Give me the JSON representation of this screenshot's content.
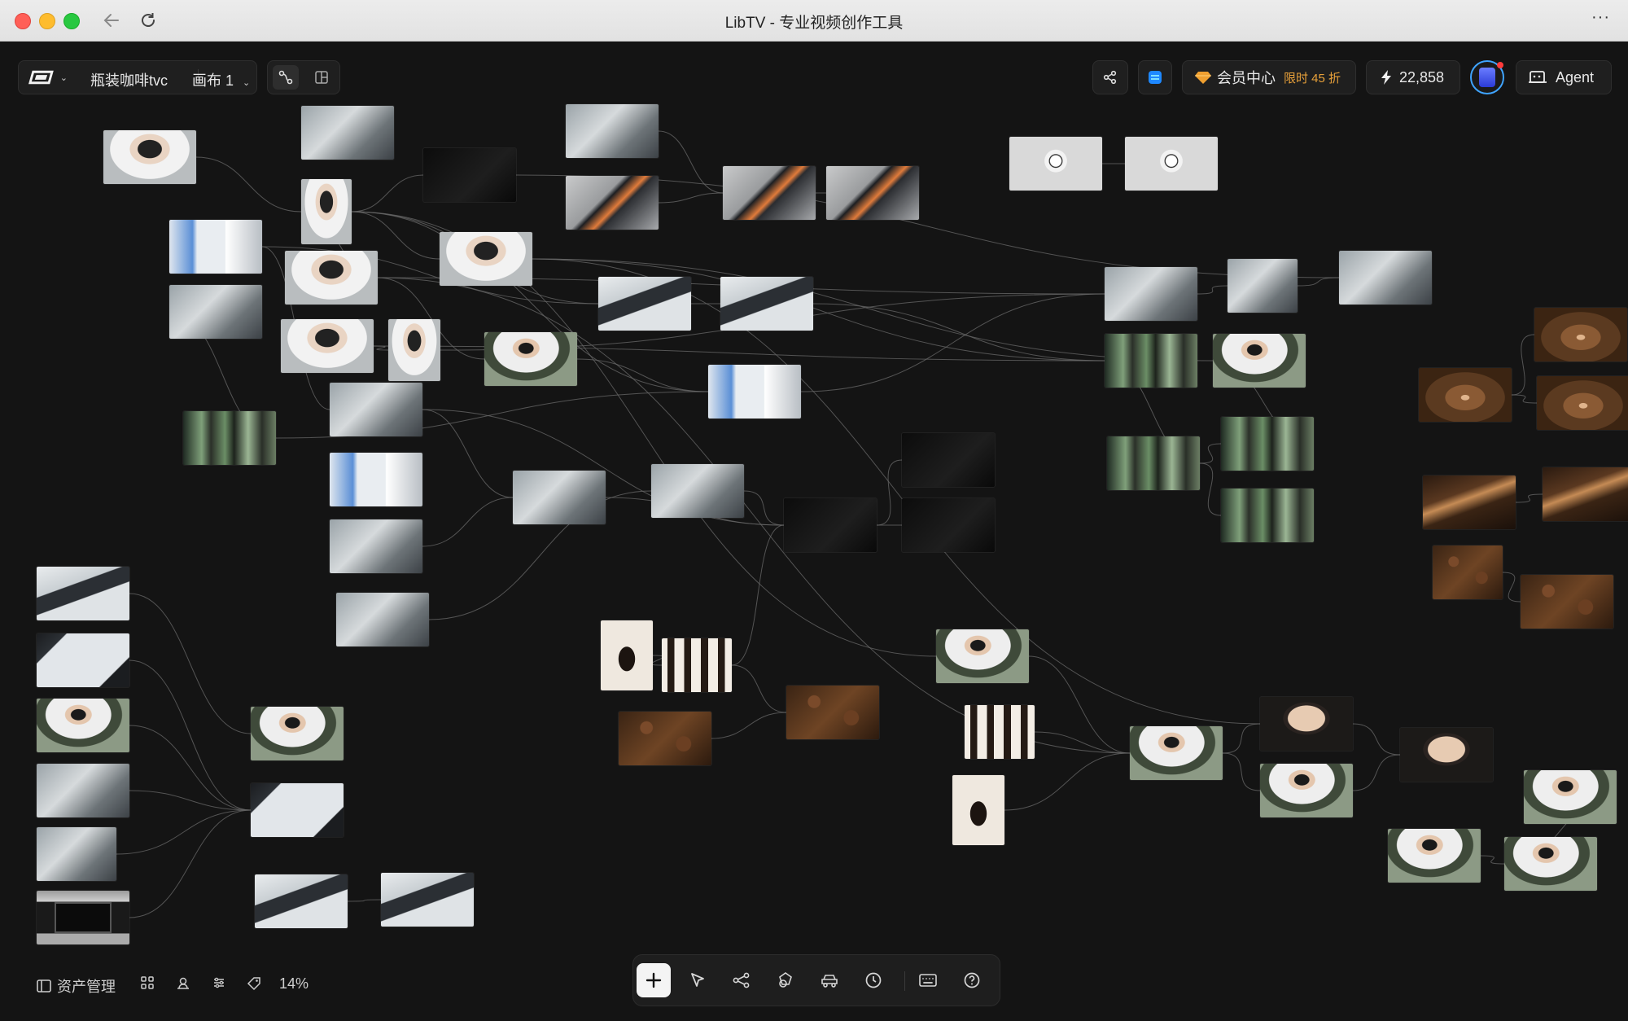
{
  "window": {
    "title": "LibTV - 专业视频创作工具",
    "traffic_lights": [
      "close",
      "minimize",
      "zoom"
    ],
    "nav_icons": [
      "back-arrow-icon",
      "reload-icon"
    ],
    "more_icon": "more-dots-icon"
  },
  "toolbar_left": {
    "logo_icon": "libtv-logo-icon",
    "project_name": "瓶装咖啡tvc",
    "canvas_name": "画布 1",
    "view_icons": [
      "connect-mode-icon",
      "layout-panel-icon"
    ]
  },
  "toolbar_right": {
    "share_icon": "share-icon",
    "app_icon": "storage-icon",
    "member_label": "会员中心",
    "member_promo": "限时 45 折",
    "credits": "22,858",
    "agent_label": "Agent"
  },
  "bottom_left": {
    "asset_label": "资产管理",
    "icons": [
      "grid-icon",
      "user-icon",
      "filter-icon",
      "tag-icon"
    ],
    "zoom": "14%"
  },
  "bottom_tools": [
    {
      "name": "add-node-tool",
      "icon": "plus-icon",
      "active": true
    },
    {
      "name": "select-tool",
      "icon": "cursor-icon",
      "active": false
    },
    {
      "name": "workflow-tool",
      "icon": "share-nodes-icon",
      "active": false
    },
    {
      "name": "shapes-tool",
      "icon": "shapes-icon",
      "active": false
    },
    {
      "name": "vehicle-tool",
      "icon": "car-icon",
      "active": false
    },
    {
      "name": "history-tool",
      "icon": "clock-icon",
      "active": false
    },
    {
      "name": "keyboard-tool",
      "icon": "keyboard-icon",
      "active": false
    },
    {
      "name": "help-tool",
      "icon": "help-icon",
      "active": false
    }
  ],
  "colors": {
    "canvas": "#141414",
    "accent_gold": "#f0a030",
    "promo_text": "#e8a13a",
    "app_blue": "#1e88ff",
    "wire": "#6a6a6a"
  }
}
